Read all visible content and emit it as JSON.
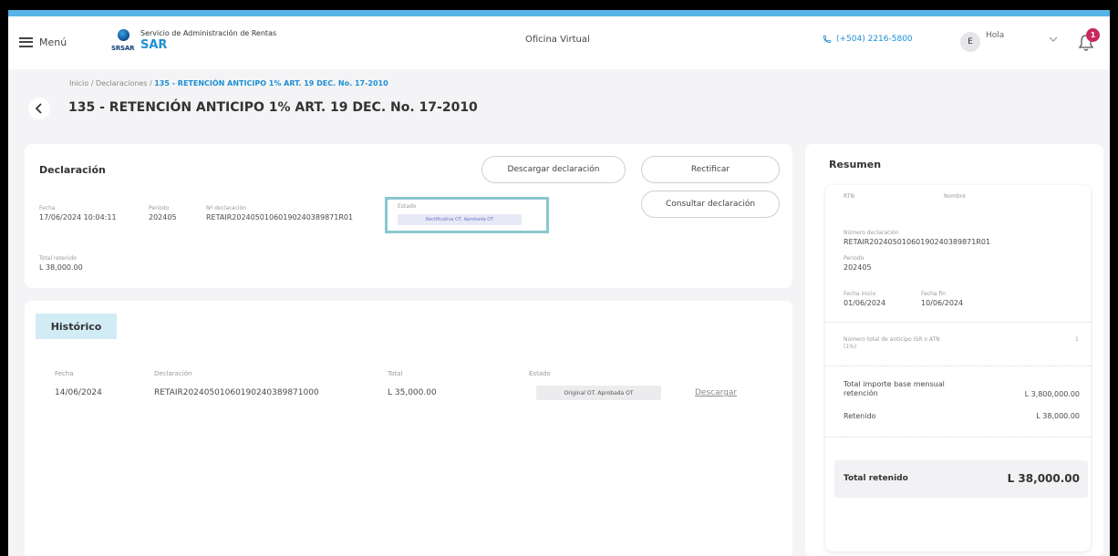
{
  "header": {
    "menu_label": "Menú",
    "logo_small": "SRSAR",
    "org_name": "Servicio de Administración de Rentas",
    "brand": "SAR",
    "oficina": "Oficina Virtual",
    "phone": "(+504) 2216-5800",
    "avatar_initial": "E",
    "greeting": "Hola",
    "notification_count": "1"
  },
  "breadcrumb": {
    "prefix": "Inicio / Declaraciones / ",
    "current": "135 - RETENCIÓN ANTICIPO 1% ART. 19 DEC. No. 17-2010"
  },
  "page_title": "135 - RETENCIÓN ANTICIPO 1% ART. 19 DEC. No. 17-2010",
  "declaracion": {
    "title": "Declaración",
    "fecha_label": "Fecha",
    "fecha": "17/06/2024 10:04:11",
    "periodo_label": "Periodo",
    "periodo": "202405",
    "numero_label": "Nº declaración",
    "numero": "RETAIR20240501060190240389871R01",
    "estado_label": "Estado",
    "estado": "Rectificativa OT. Aprobada OT",
    "total_label": "Total retenido",
    "total": "L 38,000.00",
    "btn_descargar": "Descargar declaración",
    "btn_rectificar": "Rectificar",
    "btn_consultar": "Consultar declaración"
  },
  "historico": {
    "title": "Histórico",
    "columns": [
      "Fecha",
      "Declaración",
      "Total",
      "Estado"
    ],
    "rows": [
      {
        "fecha": "14/06/2024",
        "declaracion": "RETAIR20240501060190240389871000",
        "total": "L 35,000.00",
        "estado": "Original OT. Aprobada OT",
        "action": "Descargar"
      }
    ]
  },
  "resumen": {
    "title": "Resumen",
    "rtn_label": "RTN",
    "nombre_label": "Nombre",
    "numero_label": "Número declaración",
    "numero": "RETAIR20240501060190240389871R01",
    "periodo_label": "Periodo",
    "periodo": "202405",
    "fecha_inicio_label": "Fecha inicio",
    "fecha_inicio": "01/06/2024",
    "fecha_fin_label": "Fecha fin",
    "fecha_fin": "10/06/2024",
    "anticipo_label_1": "Número total de anticipo ISR o ATN",
    "anticipo_label_2": "(1%)",
    "anticipo_value": "1",
    "base_label_1": "Total importe base mensual",
    "base_label_2": "retención",
    "base_value": "L 3,800,000.00",
    "retenido_label": "Retenido",
    "retenido_value": "L 38,000.00",
    "total_label": "Total retenido",
    "total_value": "L 38,000.00"
  }
}
